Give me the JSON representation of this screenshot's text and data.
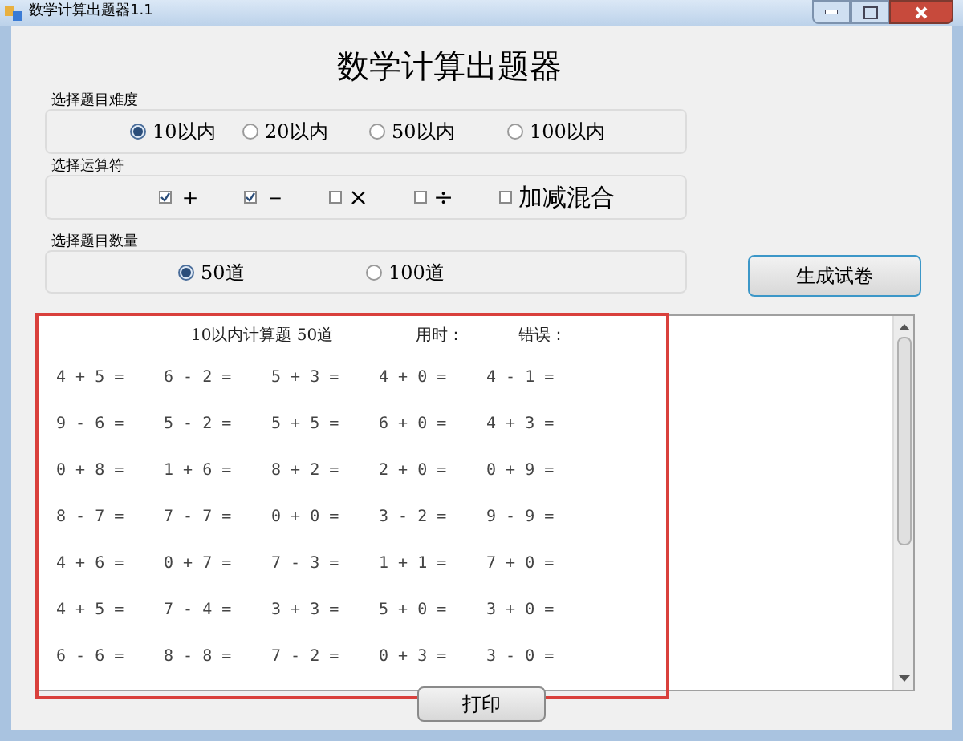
{
  "window": {
    "title": "数学计算出题器1.1"
  },
  "heading": "数学计算出题器",
  "difficulty": {
    "label": "选择题目难度",
    "options": [
      {
        "label": "10以内",
        "selected": true
      },
      {
        "label": "20以内",
        "selected": false
      },
      {
        "label": "50以内",
        "selected": false
      },
      {
        "label": "100以内",
        "selected": false
      }
    ]
  },
  "operators": {
    "label": "选择运算符",
    "options": [
      {
        "label": "＋",
        "checked": true
      },
      {
        "label": "－",
        "checked": true
      },
      {
        "label": "×",
        "checked": false
      },
      {
        "label": "÷",
        "checked": false
      },
      {
        "label": "加减混合",
        "checked": false
      }
    ]
  },
  "count": {
    "label": "选择题目数量",
    "options": [
      {
        "label": "50道",
        "selected": true
      },
      {
        "label": "100道",
        "selected": false
      }
    ]
  },
  "generate_button": "生成试卷",
  "worksheet": {
    "header": [
      "10以内计算题 50道",
      "用时：",
      "错误："
    ],
    "rows": [
      [
        "4 + 5 =",
        "6 - 2 =",
        "5 + 3 =",
        "4 + 0 =",
        "4 - 1 ="
      ],
      [
        "9 - 6 =",
        "5 - 2 =",
        "5 + 5 =",
        "6 + 0 =",
        "4 + 3 ="
      ],
      [
        "0 + 8 =",
        "1 + 6 =",
        "8 + 2 =",
        "2 + 0 =",
        "0 + 9 ="
      ],
      [
        "8 - 7 =",
        "7 - 7 =",
        "0 + 0 =",
        "3 - 2 =",
        "9 - 9 ="
      ],
      [
        "4 + 6 =",
        "0 + 7 =",
        "7 - 3 =",
        "1 + 1 =",
        "7 + 0 ="
      ],
      [
        "4 + 5 =",
        "7 - 4 =",
        "3 + 3 =",
        "5 + 0 =",
        "3 + 0 ="
      ],
      [
        "6 - 6 =",
        "8 - 8 =",
        "7 - 2 =",
        "0 + 3 =",
        "3 - 0 ="
      ]
    ]
  },
  "print_button": "打印"
}
